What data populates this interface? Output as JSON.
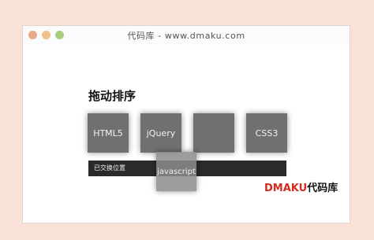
{
  "window": {
    "title": "代码库 - www.dmaku.com"
  },
  "main": {
    "heading": "拖动排序",
    "tiles": [
      {
        "label": "HTML5"
      },
      {
        "label": "jQuery"
      },
      {
        "label": ""
      },
      {
        "label": "CSS3"
      }
    ],
    "dragging_tile": {
      "label": "javascript"
    },
    "status": "已交换位置"
  },
  "watermark": {
    "latin": "DMAKU",
    "cjk": "代码库"
  },
  "colors": {
    "background": "#f9e1d8",
    "tile": "#707070",
    "status_bar": "#2b2b2b",
    "watermark_accent": "#d52b1e",
    "traffic_red": "#e9a88a",
    "traffic_yellow": "#efc08c",
    "traffic_green": "#a6d07d"
  }
}
